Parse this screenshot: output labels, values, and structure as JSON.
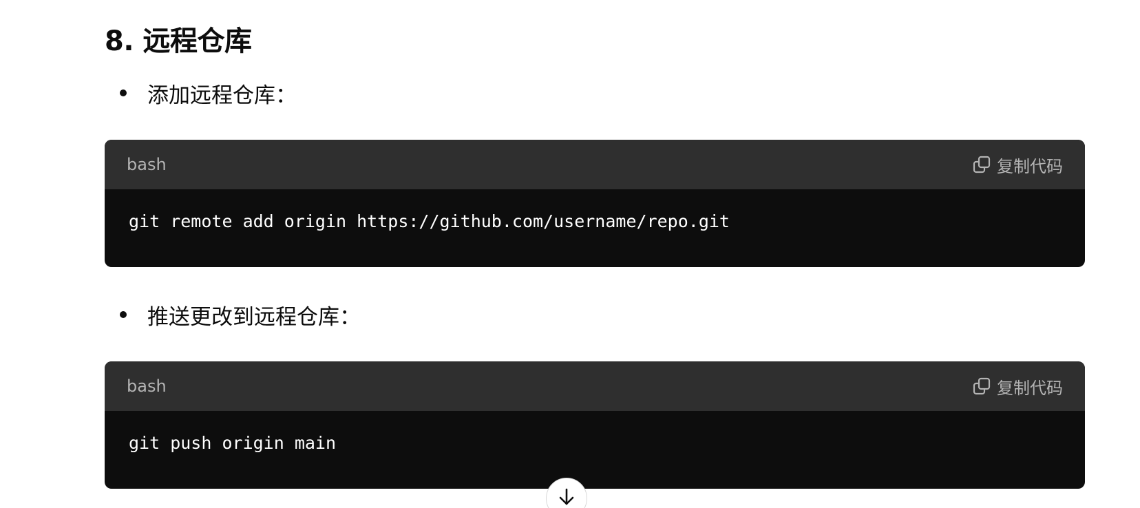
{
  "section": {
    "title": "8. 远程仓库"
  },
  "items": [
    {
      "text": "添加远程仓库：",
      "code": {
        "language": "bash",
        "copy_label": "复制代码",
        "content": "git remote add origin https://github.com/username/repo.git"
      }
    },
    {
      "text": "推送更改到远程仓库：",
      "code": {
        "language": "bash",
        "copy_label": "复制代码",
        "content": "git push origin main"
      }
    }
  ],
  "icons": {
    "copy": "copy-icon",
    "scroll_down": "arrow-down-icon"
  },
  "colors": {
    "code_header_bg": "#2f2f2f",
    "code_body_bg": "#0d0d0d",
    "header_text": "#b4b4b4",
    "code_text": "#ffffff"
  }
}
